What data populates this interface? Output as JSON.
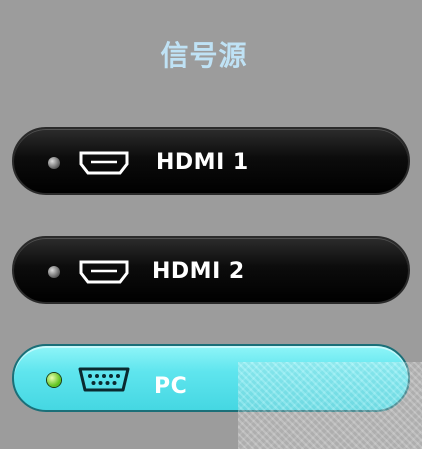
{
  "title": "信号源",
  "sources": [
    {
      "label": "HDMI 1",
      "port": "hdmi-port-icon",
      "selected": false
    },
    {
      "label": "HDMI 2",
      "port": "hdmi-port-icon",
      "selected": false
    },
    {
      "label": "PC",
      "port": "vga-port-icon",
      "selected": true
    }
  ],
  "colors": {
    "background": "#9c9c9c",
    "title": "#bfe2f5",
    "active_button": "#5fe5ee",
    "inactive_button": "#000000",
    "active_led": "#5fc21e",
    "inactive_led": "#8a8a8a"
  }
}
